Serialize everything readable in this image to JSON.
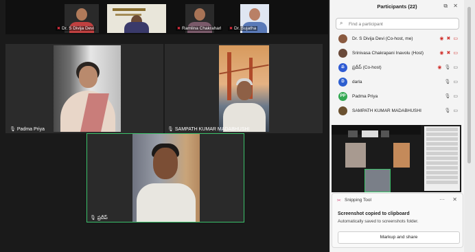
{
  "top_thumbnails": [
    {
      "label": "Dr. S Divija Devi"
    },
    {
      "label": ""
    },
    {
      "label": "Ramlina Chakraharl"
    },
    {
      "label": "Dr. Sujatha"
    }
  ],
  "tiles": {
    "padma_label": "Padma Priya",
    "sampath_label": "SAMPATH KUMAR MADABHUSHI",
    "active_label": "ప్రదీప్"
  },
  "panel": {
    "title": "Participants (22)",
    "search_placeholder": "Find a participant",
    "participants": [
      {
        "name": "Dr. S Divija Devi (Co-host, me)",
        "avatar_color": "#8a5a40",
        "avatar_text": ""
      },
      {
        "name": "Srinivasa Chakrapani Inavolu (Host)",
        "avatar_color": "#6a4a3a",
        "avatar_text": ""
      },
      {
        "name": "ప్రదీప్ (Co-host)",
        "avatar_color": "#2f5bd3",
        "avatar_text": "ప"
      },
      {
        "name": "darla",
        "avatar_color": "#2d5fd0",
        "avatar_text": "D"
      },
      {
        "name": "Padma Priya",
        "avatar_color": "#33a852",
        "avatar_text": "PP"
      },
      {
        "name": "SAMPATH KUMAR MADABHUSHI",
        "avatar_color": "#6b5130",
        "avatar_text": ""
      }
    ]
  },
  "toast": {
    "app": "Snipping Tool",
    "title": "Screenshot copied to clipboard",
    "subtitle": "Automatically saved to screenshots folder.",
    "button": "Markup and share"
  }
}
